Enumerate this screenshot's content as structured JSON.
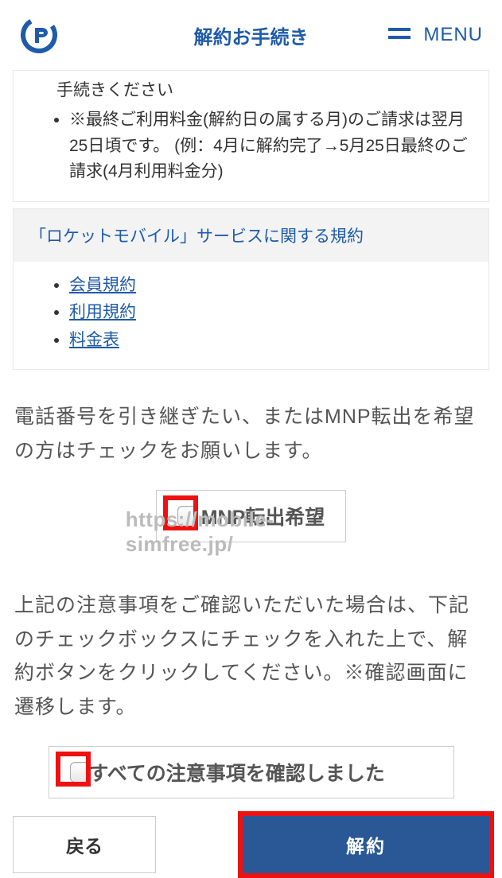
{
  "header": {
    "title": "解約お手続き",
    "menu_label": "MENU"
  },
  "notice_card": {
    "cut_line": "手続きください",
    "bullet": "※最終ご利用料金(解約日の属する月)のご請求は翌月25日頃です。 (例：4月に解約完了→5月25日最終のご請求(4月利用料金分)"
  },
  "terms_card": {
    "header": "「ロケットモバイル」サービスに関する規約",
    "links": [
      "会員規約",
      "利用規約",
      "料金表"
    ]
  },
  "section_mnp": {
    "instruction": "電話番号を引き継ぎたい、またはMNP転出を希望の方はチェックをお願いします。",
    "checkbox_label": "MNP転出希望"
  },
  "section_confirm": {
    "instruction": "上記の注意事項をご確認いただいた場合は、下記のチェックボックスにチェックを入れた上で、解約ボタンをクリックしてください。※確認画面に遷移します。",
    "checkbox_label": "すべての注意事項を確認しました"
  },
  "buttons": {
    "back": "戻る",
    "submit": "解約"
  },
  "watermark": "https://mobile-simfree.jp/"
}
